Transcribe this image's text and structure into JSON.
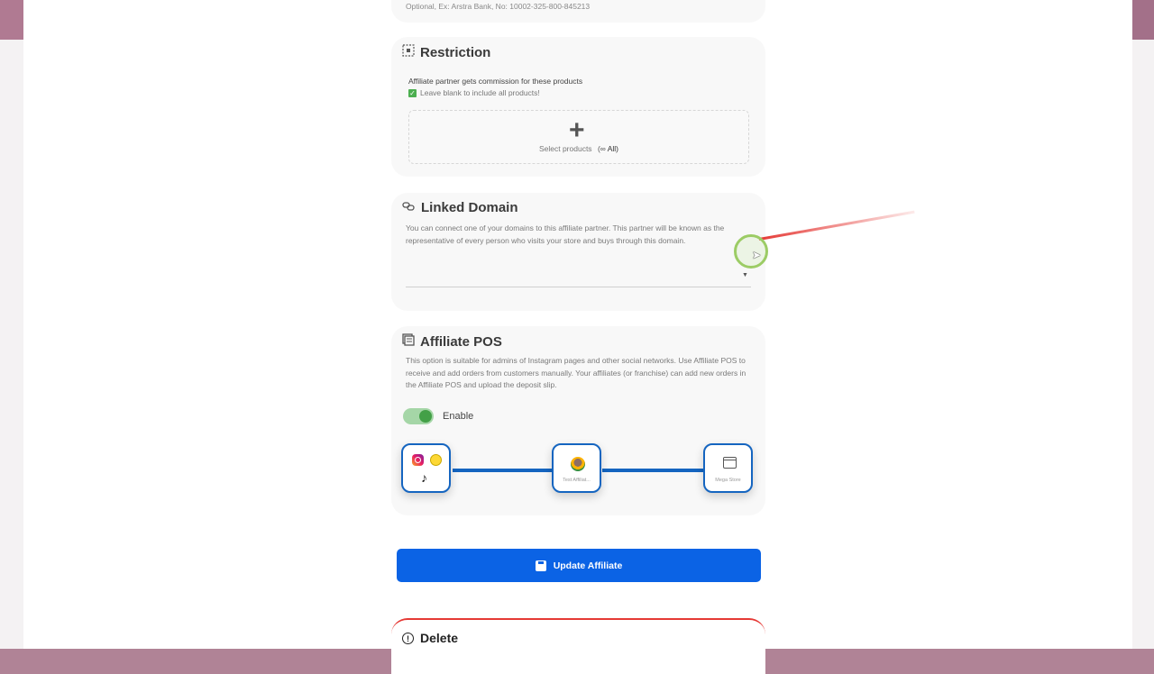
{
  "top_section": {
    "hint": "Optional, Ex: Arstra Bank, No: 10002-325-800-845213"
  },
  "restriction": {
    "title": "Restriction",
    "label": "Affiliate partner gets commission for these products",
    "checkbox_label": "Leave blank to include all products!",
    "select_text": "Select products",
    "infinity_symbol": "(∞",
    "all_text": "All)"
  },
  "linked_domain": {
    "title": "Linked Domain",
    "description": "You can connect one of your domains to this affiliate partner. This partner will be known as the representative of every person who visits your store and buys through this domain.",
    "selected_value": ""
  },
  "affiliate_pos": {
    "title": "Affiliate POS",
    "description": "This option is suitable for admins of Instagram pages and other social networks. Use Affiliate POS to receive and add orders from customers manually. Your affiliates (or franchise) can add new orders in the Affiliate POS and upload the deposit slip.",
    "toggle_label": "Enable",
    "toggle_on": true,
    "nodes": [
      {
        "icon": "social-networks-icon",
        "caption": ""
      },
      {
        "icon": "affiliate-avatar-icon",
        "caption": "Test Affiliat..."
      },
      {
        "icon": "store-icon",
        "caption": "Mega Store"
      }
    ]
  },
  "update_button": {
    "label": "Update Affiliate",
    "color": "#0b63e5"
  },
  "delete_section": {
    "title": "Delete",
    "accent": "#e53935"
  }
}
